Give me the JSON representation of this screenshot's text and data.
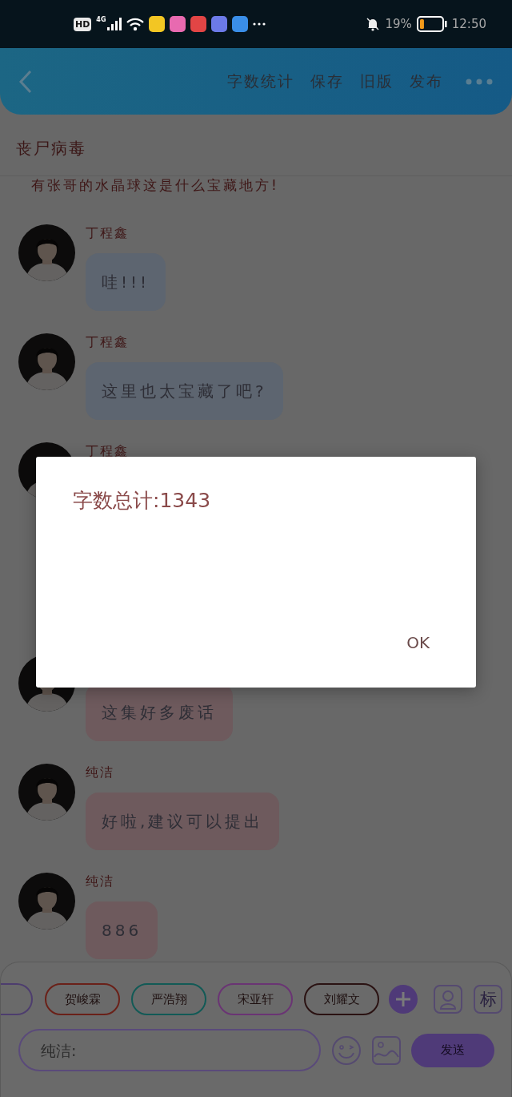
{
  "status_bar": {
    "hd": "HD",
    "network": "4G",
    "battery": "19%",
    "time": "12:50"
  },
  "header": {
    "actions": [
      "字数统计",
      "保存",
      "旧版",
      "发布"
    ]
  },
  "document_title": "丧尸病毒",
  "partial_line": "有张哥的水晶球这是什么宝藏地方!",
  "messages": [
    {
      "name": "丁程鑫",
      "text": "哇!!!",
      "color": "#5d6570"
    },
    {
      "name": "丁程鑫",
      "text": "这里也太宝藏了吧?",
      "color": "#5d6570"
    },
    {
      "name": "丁程鑫"
    },
    {
      "text": "这集好多废话",
      "color": "#6e5a5d"
    },
    {
      "name": "纯洁",
      "text": "好啦,建议可以提出",
      "color": "#6e5a5d"
    },
    {
      "name": "纯洁",
      "text": "886",
      "color": "#6e5a5d"
    }
  ],
  "chips": [
    {
      "color": "#4d3d6e"
    },
    {
      "label": "贺峻霖",
      "color": "#6a2018"
    },
    {
      "label": "严浩翔",
      "color": "#125a56"
    },
    {
      "label": "宋亚轩",
      "color": "#6a3474"
    },
    {
      "label": "刘耀文",
      "color": "#2a1212"
    }
  ],
  "tag_button": "标",
  "input": {
    "placeholder": "纯洁:"
  },
  "send_button": "发送",
  "dialog": {
    "message": "字数总计:1343",
    "button": "OK"
  }
}
